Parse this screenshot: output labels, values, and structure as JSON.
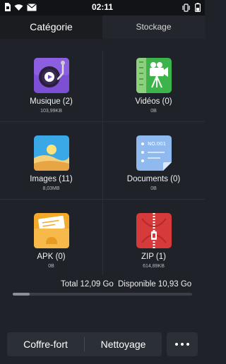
{
  "status_bar": {
    "time": "02:11",
    "left_icons": [
      "sim-card-icon",
      "wifi-icon",
      "mail-icon"
    ],
    "right_icons": [
      "vibrate-icon",
      "battery-icon"
    ]
  },
  "tabs": [
    {
      "label": "Catégorie",
      "active": true
    },
    {
      "label": "Stockage",
      "active": false
    }
  ],
  "categories": [
    {
      "label": "Musique (2)",
      "size": "103,99KB",
      "icon": "music-icon",
      "color": "#7d4fd4"
    },
    {
      "label": "Vidéos (0)",
      "size": "0B",
      "icon": "video-camera-icon",
      "color": "#3cb34b"
    },
    {
      "label": "Images (11)",
      "size": "8,03MB",
      "icon": "image-icon",
      "color": "#3aa8e6"
    },
    {
      "label": "Documents (0)",
      "size": "0B",
      "icon": "document-icon",
      "color": "#8fb9ef"
    },
    {
      "label": "APK (0)",
      "size": "0B",
      "icon": "apk-folder-icon",
      "color": "#f3a92a"
    },
    {
      "label": "ZIP (1)",
      "size": "614,89KB",
      "icon": "zip-icon",
      "color": "#d63a3a"
    }
  ],
  "storage": {
    "total_text": "Total 12,09 Go",
    "available_text": "Disponible 10,93 Go",
    "used_fraction": 0.096
  },
  "bottom": {
    "safe_label": "Coffre-fort",
    "clean_label": "Nettoyage",
    "more_icon": "more-icon"
  }
}
